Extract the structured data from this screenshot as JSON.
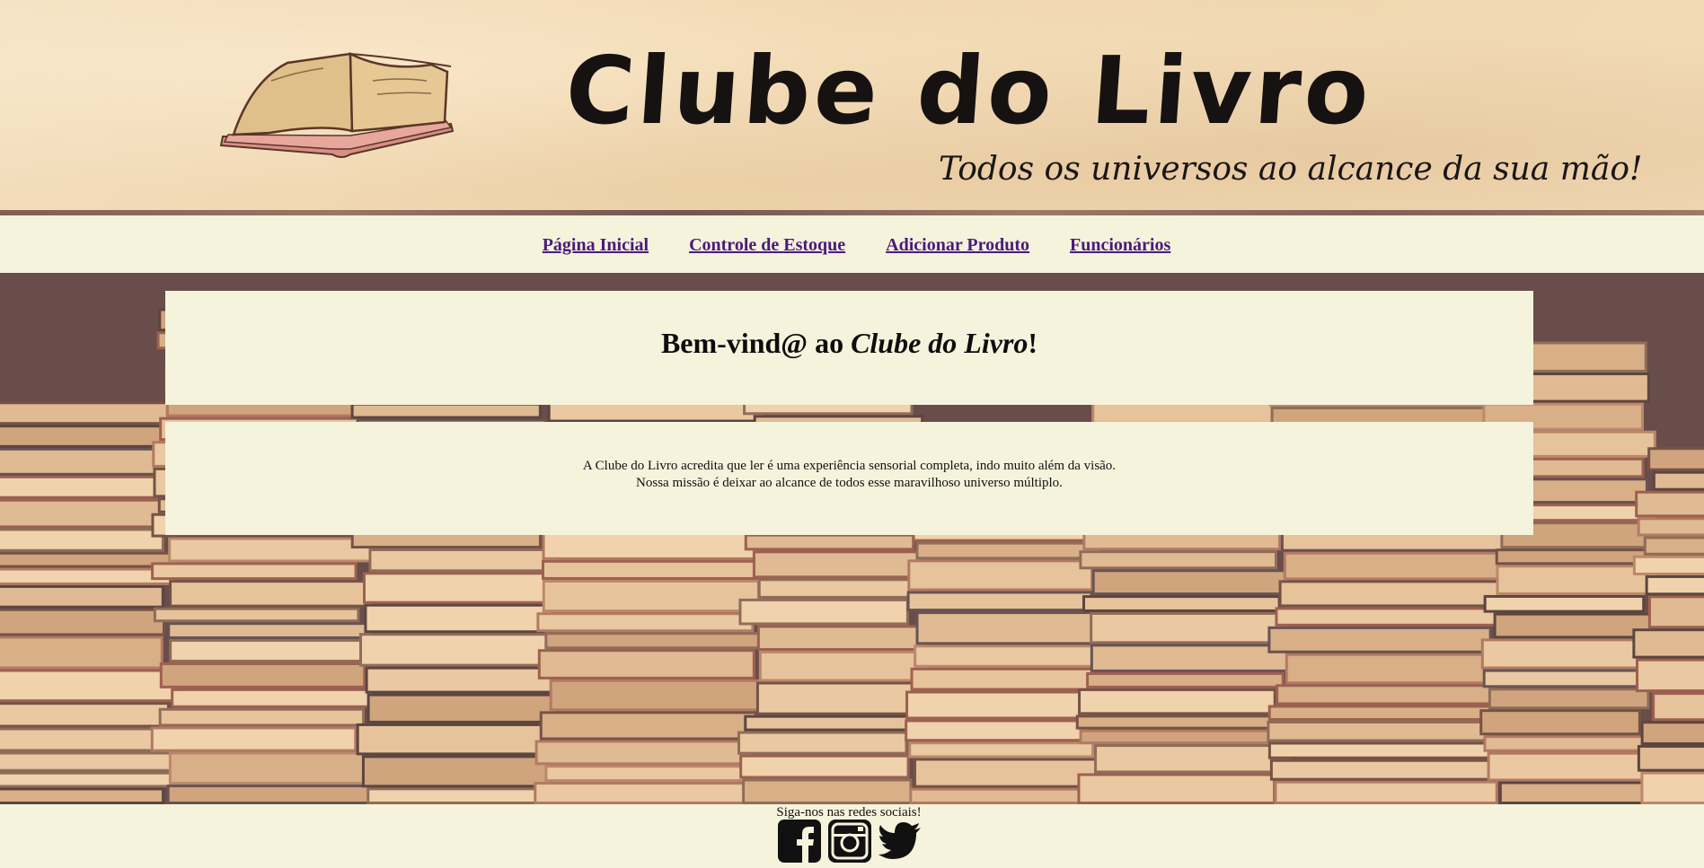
{
  "banner": {
    "title": "Clube do Livro",
    "tagline": "Todos os universos ao alcance da sua mão!",
    "logo_icon": "open-book-icon"
  },
  "nav": {
    "items": [
      {
        "label": "Página Inicial"
      },
      {
        "label": "Controle de Estoque"
      },
      {
        "label": "Adicionar Produto"
      },
      {
        "label": "Funcionários"
      }
    ]
  },
  "welcome": {
    "prefix": "Bem-vind@ ao ",
    "brand": "Clube do Livro",
    "suffix": "!"
  },
  "about": {
    "line1": "A Clube do Livro acredita que ler é uma experiência sensorial completa, indo muito além da visão.",
    "line2": "Nossa missão é deixar ao alcance de todos esse maravilhoso universo múltiplo."
  },
  "footer": {
    "text": "Siga-nos nas redes sociais!",
    "icons": [
      "facebook-icon",
      "instagram-icon",
      "twitter-icon"
    ]
  },
  "colors": {
    "cream": "#f5f3dc",
    "link": "#4b1a7c",
    "banner": "#f0d8b3"
  }
}
